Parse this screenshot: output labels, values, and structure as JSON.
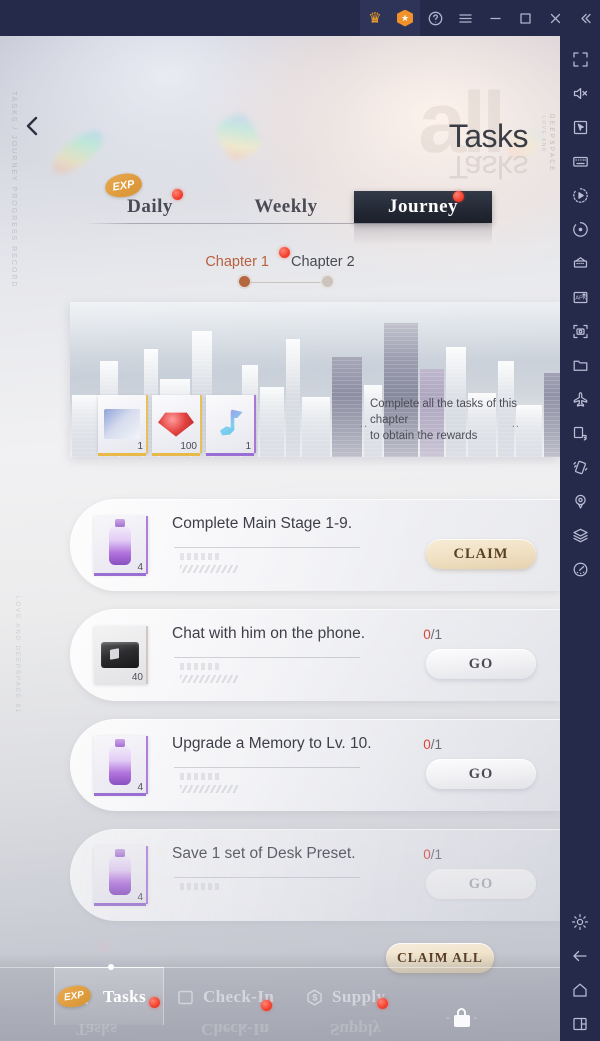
{
  "titlebar": {
    "buttons": [
      {
        "name": "premium-crown",
        "glyph": "crown"
      },
      {
        "name": "shield-badge",
        "glyph": "shield"
      },
      {
        "name": "help",
        "glyph": "question"
      },
      {
        "name": "menu",
        "glyph": "hamburger"
      },
      {
        "name": "minimize",
        "glyph": "minus"
      },
      {
        "name": "maximize",
        "glyph": "square"
      },
      {
        "name": "close",
        "glyph": "x"
      },
      {
        "name": "collapse",
        "glyph": "double-chevron-left"
      }
    ]
  },
  "sidebar": {
    "top_tools": [
      {
        "name": "fullscreen-icon",
        "tooltip": "Fullscreen"
      },
      {
        "name": "mute-icon",
        "tooltip": "Mute"
      },
      {
        "name": "cursor-icon",
        "tooltip": "Pointer"
      },
      {
        "name": "keymapping-icon",
        "tooltip": "Keymapping"
      },
      {
        "name": "macro-record-icon",
        "tooltip": "Macro"
      },
      {
        "name": "sync-icon",
        "tooltip": "Sync"
      },
      {
        "name": "multi-instance-icon",
        "tooltip": "Multi-instance"
      },
      {
        "name": "install-apk-icon",
        "tooltip": "Install APK"
      },
      {
        "name": "screenshot-icon",
        "tooltip": "Screenshot"
      },
      {
        "name": "folder-icon",
        "tooltip": "Media Manager"
      },
      {
        "name": "airplane-icon",
        "tooltip": "Airplane"
      },
      {
        "name": "rotate-screen-icon",
        "tooltip": "Rotate"
      },
      {
        "name": "shake-icon",
        "tooltip": "Shake"
      },
      {
        "name": "location-icon",
        "tooltip": "Location"
      },
      {
        "name": "layers-icon",
        "tooltip": "Layers"
      },
      {
        "name": "performance-icon",
        "tooltip": "Performance"
      }
    ],
    "bottom_tools": [
      {
        "name": "settings-gear-icon",
        "tooltip": "Settings"
      },
      {
        "name": "back-arrow-icon",
        "tooltip": "Back"
      },
      {
        "name": "home-icon",
        "tooltip": "Home"
      },
      {
        "name": "recents-icon",
        "tooltip": "Recents"
      }
    ]
  },
  "game": {
    "brand_vertical": "DEEPSPACE",
    "brand_vertical_sub": "LOVE AND",
    "left_deco": "TASKS / JOURNEY PROGRESS RECORD",
    "left_deco2": "LOVE AND DEEPSPACE 01",
    "ghost_title": "all",
    "page_title": "Tasks",
    "back_icon": "back-chevron-icon",
    "exp_badge": "EXP",
    "tabs": [
      {
        "label": "Daily",
        "active": false,
        "badge": true
      },
      {
        "label": "Weekly",
        "active": false,
        "badge": false
      },
      {
        "label": "Journey",
        "active": true,
        "badge": true
      }
    ],
    "chapters": [
      {
        "label": "Chapter 1",
        "active": true,
        "badge": true
      },
      {
        "label": "Chapter 2",
        "active": false,
        "badge": false
      }
    ],
    "banner": {
      "note_line1": "Complete all the tasks of this chapter",
      "note_line2": "to obtain the rewards",
      "dots_left": "..",
      "dots_right": "..",
      "rewards": [
        {
          "name": "reward-card",
          "qty": "1",
          "rarity": "gold"
        },
        {
          "name": "reward-gem",
          "qty": "100",
          "rarity": "gold"
        },
        {
          "name": "reward-note",
          "qty": "1",
          "rarity": "purple"
        }
      ]
    },
    "tasks": [
      {
        "title": "Complete Main Stage 1-9.",
        "progress": "",
        "progress_num": "",
        "progress_den": "",
        "button": "CLAIM",
        "button_type": "claim",
        "reward_qty": "4",
        "reward_art": "potion",
        "disabled": false
      },
      {
        "title": "Chat with him on the phone.",
        "progress": "0/1",
        "progress_num": "0",
        "progress_den": "/1",
        "button": "GO",
        "button_type": "go",
        "reward_qty": "40",
        "reward_art": "box",
        "disabled": false
      },
      {
        "title": "Upgrade a Memory to Lv. 10.",
        "progress": "0/1",
        "progress_num": "0",
        "progress_den": "/1",
        "button": "GO",
        "button_type": "go",
        "reward_qty": "4",
        "reward_art": "potion",
        "disabled": false
      },
      {
        "title": "Save 1 set of Desk Preset.",
        "progress": "0/1",
        "progress_num": "0",
        "progress_den": "/1",
        "button": "GO",
        "button_type": "go",
        "reward_qty": "4",
        "reward_art": "potion",
        "disabled": true
      }
    ],
    "claim_all": "CLAIM ALL",
    "bottom_nav": [
      {
        "label": "Tasks",
        "icon": "tasks-icon",
        "active": true,
        "badge": true
      },
      {
        "label": "Check-In",
        "icon": "checkbox-icon",
        "active": false,
        "badge": true
      },
      {
        "label": "Supply",
        "icon": "supply-icon",
        "active": false,
        "badge": true
      }
    ],
    "bottom_exp_badge": "EXP",
    "locked_icon": "lock-icon"
  },
  "colors": {
    "titlebar_bg": "#252a4a",
    "accent_orange": "#e8a84e",
    "accent_red_dot": "#f5402e",
    "chapter_active": "#b8603f",
    "claim_bg": "#f0e0c2",
    "progress_red": "#d8453a"
  }
}
